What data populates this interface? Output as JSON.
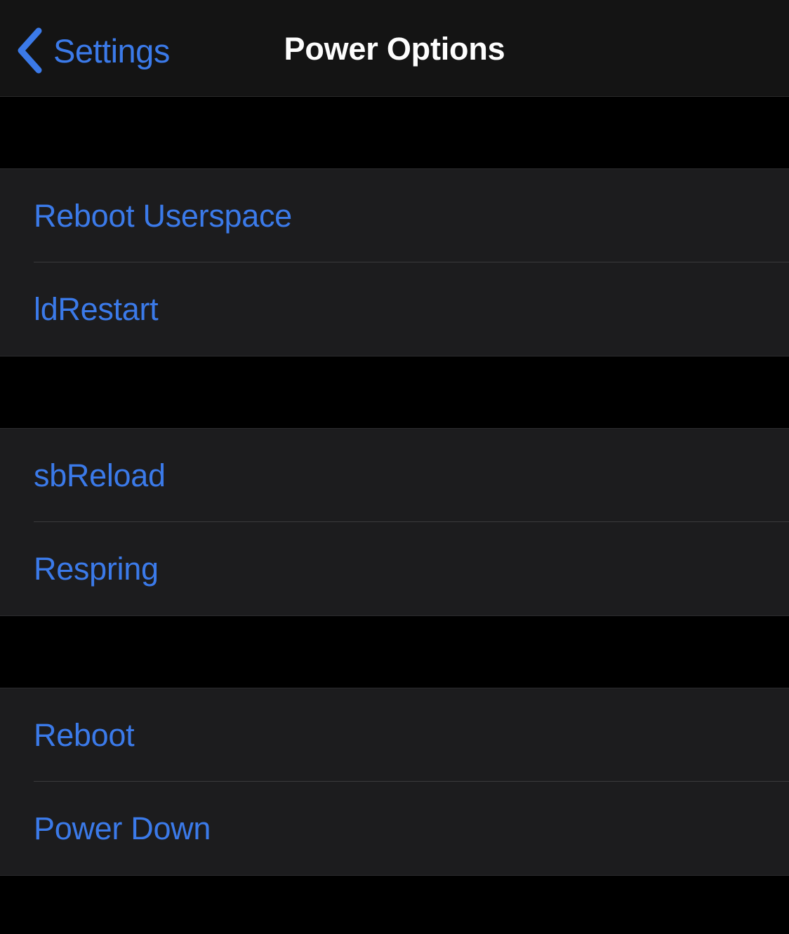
{
  "navbar": {
    "back_label": "Settings",
    "back_icon": "chevron-left-icon",
    "title": "Power Options",
    "tint_color": "#3b7ae9",
    "title_color": "#fdfdfd",
    "background_color": "#141414"
  },
  "screen": {
    "background_color": "#000000",
    "group_background_color": "#1c1c1e",
    "separator_color": "#3a3a3c"
  },
  "sections": [
    {
      "id": "userspace-section",
      "rows": [
        {
          "id": "reboot-userspace",
          "label": "Reboot Userspace"
        },
        {
          "id": "ldrestart",
          "label": "ldRestart"
        }
      ]
    },
    {
      "id": "springboard-section",
      "rows": [
        {
          "id": "sbreload",
          "label": "sbReload"
        },
        {
          "id": "respring",
          "label": "Respring"
        }
      ]
    },
    {
      "id": "device-power-section",
      "rows": [
        {
          "id": "reboot",
          "label": "Reboot"
        },
        {
          "id": "power-down",
          "label": "Power Down"
        }
      ]
    }
  ]
}
